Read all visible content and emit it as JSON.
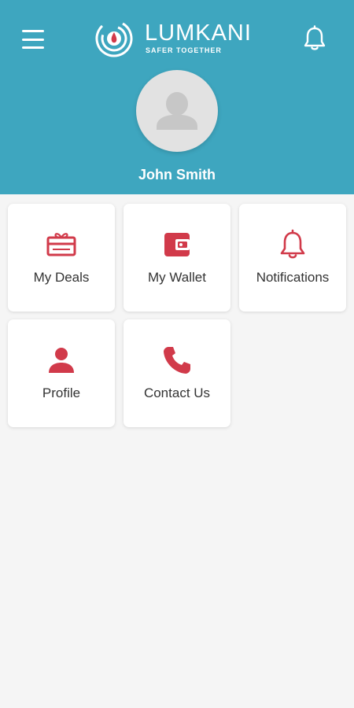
{
  "header": {
    "brand_name": "LUMKANI",
    "brand_tagline": "SAFER TOGETHER",
    "menu_icon": "hamburger-menu-icon",
    "notifications_icon": "bell-icon",
    "background_color": "#3ea6bf"
  },
  "user": {
    "name": "John Smith",
    "avatar_icon": "person-silhouette-icon"
  },
  "tiles": [
    {
      "label": "My Deals",
      "icon": "gift-card-icon"
    },
    {
      "label": "My Wallet",
      "icon": "wallet-icon"
    },
    {
      "label": "Notifications",
      "icon": "bell-icon"
    },
    {
      "label": "Profile",
      "icon": "user-icon"
    },
    {
      "label": "Contact Us",
      "icon": "phone-icon"
    }
  ],
  "colors": {
    "accent": "#d13a4a",
    "header": "#3ea6bf",
    "page_background": "#f5f5f5",
    "tile_background": "#ffffff"
  }
}
